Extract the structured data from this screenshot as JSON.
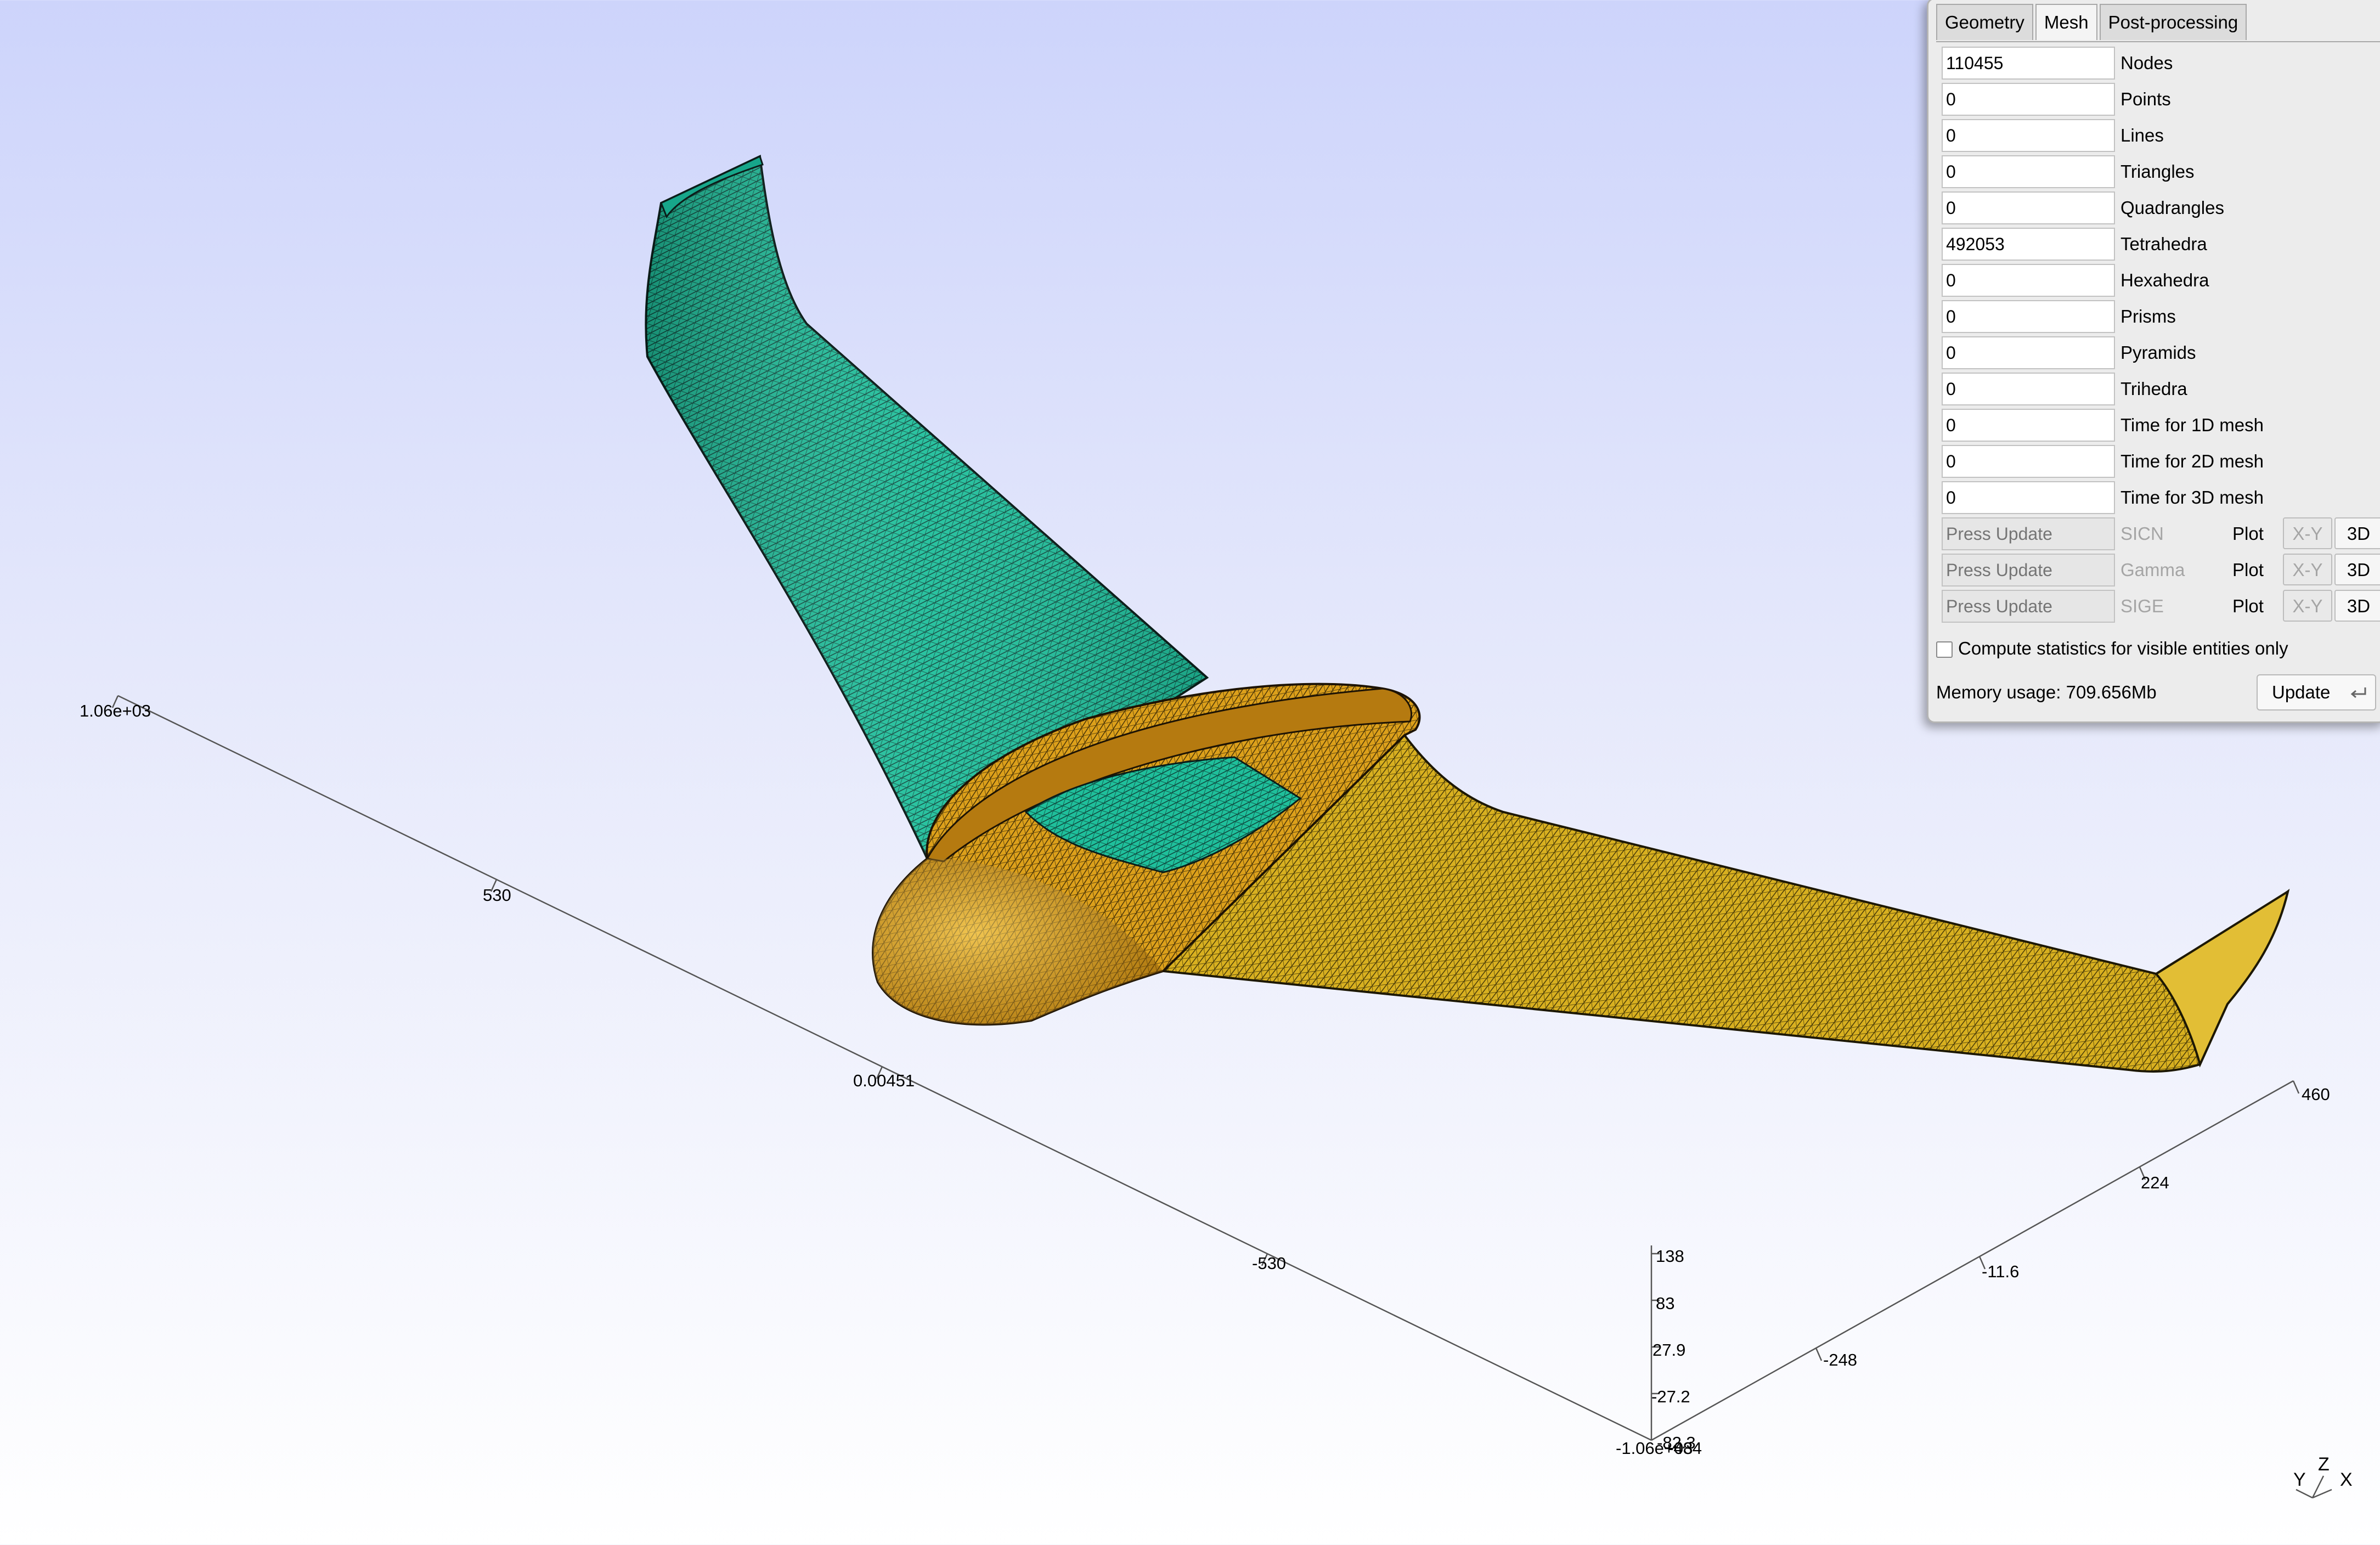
{
  "viewport": {
    "axes": {
      "x_ticks": [
        "1.06e+03",
        "530",
        "0.00451",
        "-530"
      ],
      "y_ticks": [
        "460",
        "224",
        "-11.6",
        "-248"
      ],
      "z_ticks": [
        "138",
        "83",
        "27.9",
        "-27.2",
        "-82.3"
      ],
      "origin_labels": [
        "-1.06e+03",
        "-484"
      ]
    },
    "triad": {
      "x": "X",
      "y": "Y",
      "z": "Z"
    },
    "colors": {
      "wing_teal": "#1fbf9b",
      "body_orange": "#e0a018",
      "mesh_lines": "#1a1a1a"
    }
  },
  "panel": {
    "tabs": [
      {
        "label": "Geometry",
        "active": false
      },
      {
        "label": "Mesh",
        "active": true
      },
      {
        "label": "Post-processing",
        "active": false
      }
    ],
    "stats": [
      {
        "value": "110455",
        "label": "Nodes"
      },
      {
        "value": "0",
        "label": "Points"
      },
      {
        "value": "0",
        "label": "Lines"
      },
      {
        "value": "0",
        "label": "Triangles"
      },
      {
        "value": "0",
        "label": "Quadrangles"
      },
      {
        "value": "492053",
        "label": "Tetrahedra"
      },
      {
        "value": "0",
        "label": "Hexahedra"
      },
      {
        "value": "0",
        "label": "Prisms"
      },
      {
        "value": "0",
        "label": "Pyramids"
      },
      {
        "value": "0",
        "label": "Trihedra"
      },
      {
        "value": "0",
        "label": "Time for 1D mesh"
      },
      {
        "value": "0",
        "label": "Time for 2D mesh"
      },
      {
        "value": "0",
        "label": "Time for 3D mesh"
      }
    ],
    "quality": [
      {
        "placeholder": "Press Update",
        "measure": "SICN",
        "plot": "Plot",
        "xy": "X-Y",
        "d3": "3D"
      },
      {
        "placeholder": "Press Update",
        "measure": "Gamma",
        "plot": "Plot",
        "xy": "X-Y",
        "d3": "3D"
      },
      {
        "placeholder": "Press Update",
        "measure": "SIGE",
        "plot": "Plot",
        "xy": "X-Y",
        "d3": "3D"
      }
    ],
    "visible_only_label": "Compute statistics for visible entities only",
    "visible_only_checked": false,
    "memory": "Memory usage: 709.656Mb",
    "update_label": "Update"
  }
}
